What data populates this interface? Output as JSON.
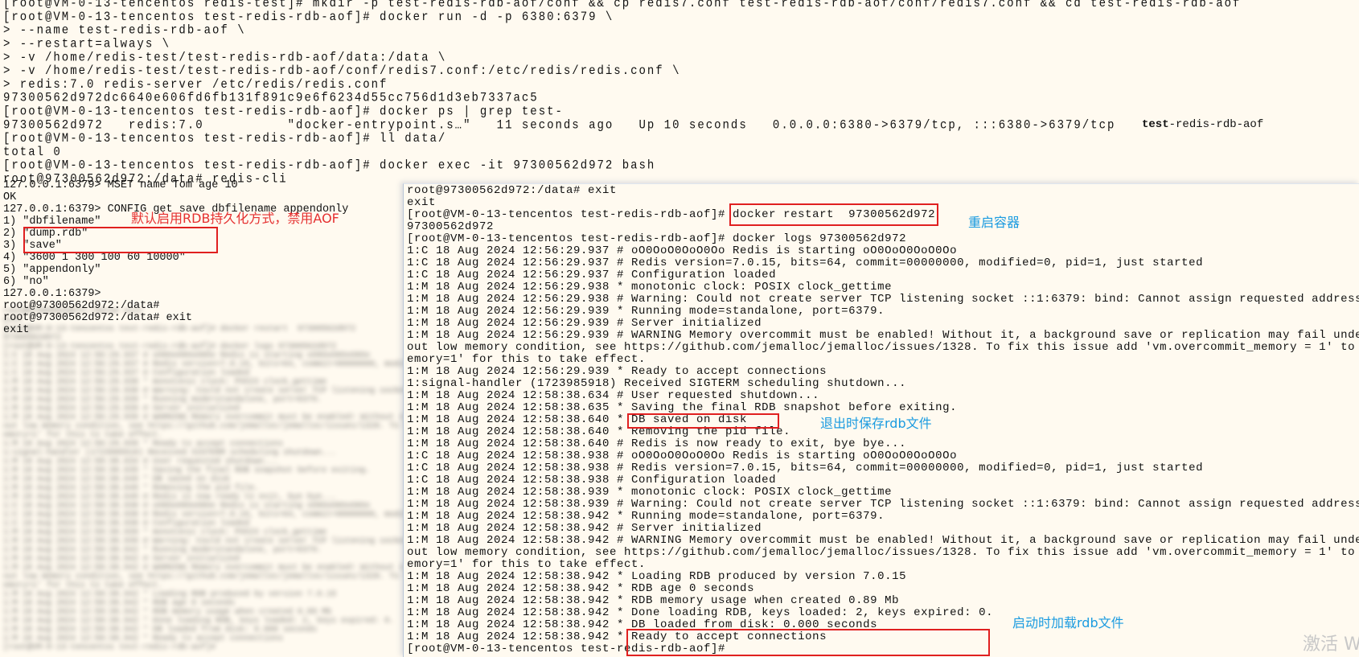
{
  "top_lines": [
    "[root@VM-0-13-tencentos redis-test]# mkdir -p test-redis-rdb-aof/conf && cp redis7.conf test-redis-rdb-aof/conf/redis7.conf && cd test-redis-rdb-aof",
    "[root@VM-0-13-tencentos test-redis-rdb-aof]# docker run -d -p 6380:6379 \\",
    "> --name test-redis-rdb-aof \\",
    "> --restart=always \\",
    "> -v /home/redis-test/test-redis-rdb-aof/data:/data \\",
    "> -v /home/redis-test/test-redis-rdb-aof/conf/redis7.conf:/etc/redis/redis.conf \\",
    "> redis:7.0 redis-server /etc/redis/redis.conf",
    "97300562d972dc6640e606fd6fb131f891c9e6f6234d55cc756d1d3eb7337ac5",
    "[root@VM-0-13-tencentos test-redis-rdb-aof]# docker ps | grep test-",
    "97300562d972   redis:7.0          \"docker-entrypoint.s…\"   11 seconds ago   Up 10 seconds   0.0.0.0:6380->6379/tcp, :::6380->6379/tcp",
    "[root@VM-0-13-tencentos test-redis-rdb-aof]# ll data/",
    "total 0",
    "[root@VM-0-13-tencentos test-redis-rdb-aof]# docker exec -it 97300562d972 bash",
    "root@97300562d972:/data# redis-cli"
  ],
  "ps_name": {
    "bold": "test",
    "rest": "-redis-rdb-aof"
  },
  "cli_lines": [
    "127.0.0.1:6379> MSET name Tom age 10",
    "OK",
    "127.0.0.1:6379> CONFIG get save dbfilename appendonly",
    "1) \"dbfilename\"",
    "2) \"dump.rdb\"",
    "3) \"save\"",
    "4) \"3600 1 300 100 60 10000\"",
    "5) \"appendonly\"",
    "6) \"no\"",
    "127.0.0.1:6379>",
    "root@97300562d972:/data#",
    "root@97300562d972:/data# exit",
    "exit"
  ],
  "panel_lines": [
    "root@97300562d972:/data# exit",
    "exit",
    "[root@VM-0-13-tencentos test-redis-rdb-aof]# docker restart  97300562d972",
    "97300562d972",
    "[root@VM-0-13-tencentos test-redis-rdb-aof]# docker logs 97300562d972",
    "1:C 18 Aug 2024 12:56:29.937 # oO0OoO0OoO0Oo Redis is starting oO0OoO0OoO0Oo",
    "1:C 18 Aug 2024 12:56:29.937 # Redis version=7.0.15, bits=64, commit=00000000, modified=0, pid=1, just started",
    "1:C 18 Aug 2024 12:56:29.937 # Configuration loaded",
    "1:M 18 Aug 2024 12:56:29.938 * monotonic clock: POSIX clock_gettime",
    "1:M 18 Aug 2024 12:56:29.938 # Warning: Could not create server TCP listening socket ::1:6379: bind: Cannot assign requested address",
    "1:M 18 Aug 2024 12:56:29.939 * Running mode=standalone, port=6379.",
    "1:M 18 Aug 2024 12:56:29.939 # Server initialized",
    "1:M 18 Aug 2024 12:56:29.939 # WARNING Memory overcommit must be enabled! Without it, a background save or replication may fail under",
    "out low memory condition, see https://github.com/jemalloc/jemalloc/issues/1328. To fix this issue add 'vm.overcommit_memory = 1' to",
    "emory=1' for this to take effect.",
    "1:M 18 Aug 2024 12:56:29.939 * Ready to accept connections",
    "1:signal-handler (1723985918) Received SIGTERM scheduling shutdown...",
    "1:M 18 Aug 2024 12:58:38.634 # User requested shutdown...",
    "1:M 18 Aug 2024 12:58:38.635 * Saving the final RDB snapshot before exiting.",
    "1:M 18 Aug 2024 12:58:38.640 * DB saved on disk",
    "1:M 18 Aug 2024 12:58:38.640 * Removing the pid file.",
    "1:M 18 Aug 2024 12:58:38.640 # Redis is now ready to exit, bye bye...",
    "1:C 18 Aug 2024 12:58:38.938 # oO0OoO0OoO0Oo Redis is starting oO0OoO0OoO0Oo",
    "1:C 18 Aug 2024 12:58:38.938 # Redis version=7.0.15, bits=64, commit=00000000, modified=0, pid=1, just started",
    "1:C 18 Aug 2024 12:58:38.938 # Configuration loaded",
    "1:M 18 Aug 2024 12:58:38.939 * monotonic clock: POSIX clock_gettime",
    "1:M 18 Aug 2024 12:58:38.939 # Warning: Could not create server TCP listening socket ::1:6379: bind: Cannot assign requested address",
    "1:M 18 Aug 2024 12:58:38.942 * Running mode=standalone, port=6379.",
    "1:M 18 Aug 2024 12:58:38.942 # Server initialized",
    "1:M 18 Aug 2024 12:58:38.942 # WARNING Memory overcommit must be enabled! Without it, a background save or replication may fail under",
    "out low memory condition, see https://github.com/jemalloc/jemalloc/issues/1328. To fix this issue add 'vm.overcommit_memory = 1' to",
    "emory=1' for this to take effect.",
    "1:M 18 Aug 2024 12:58:38.942 * Loading RDB produced by version 7.0.15",
    "1:M 18 Aug 2024 12:58:38.942 * RDB age 0 seconds",
    "1:M 18 Aug 2024 12:58:38.942 * RDB memory usage when created 0.89 Mb",
    "1:M 18 Aug 2024 12:58:38.942 * Done loading RDB, keys loaded: 2, keys expired: 0.",
    "1:M 18 Aug 2024 12:58:38.942 * DB loaded from disk: 0.000 seconds",
    "1:M 18 Aug 2024 12:58:38.942 * Ready to accept connections",
    "[root@VM-0-13-tencentos test-redis-rdb-aof]# "
  ],
  "annotations": {
    "default_rdb": "默认启用RDB持久化方式，禁用AOF",
    "restart": "重启容器",
    "save_on_exit": "退出时保存rdb文件",
    "load_on_start": "启动时加载rdb文件"
  },
  "watermark": "激活 Wind",
  "colors": {
    "annotation_red": "#e53030",
    "annotation_blue": "#1a9be0",
    "box_red": "#e02020",
    "terminal_bg": "#fffaf0"
  }
}
